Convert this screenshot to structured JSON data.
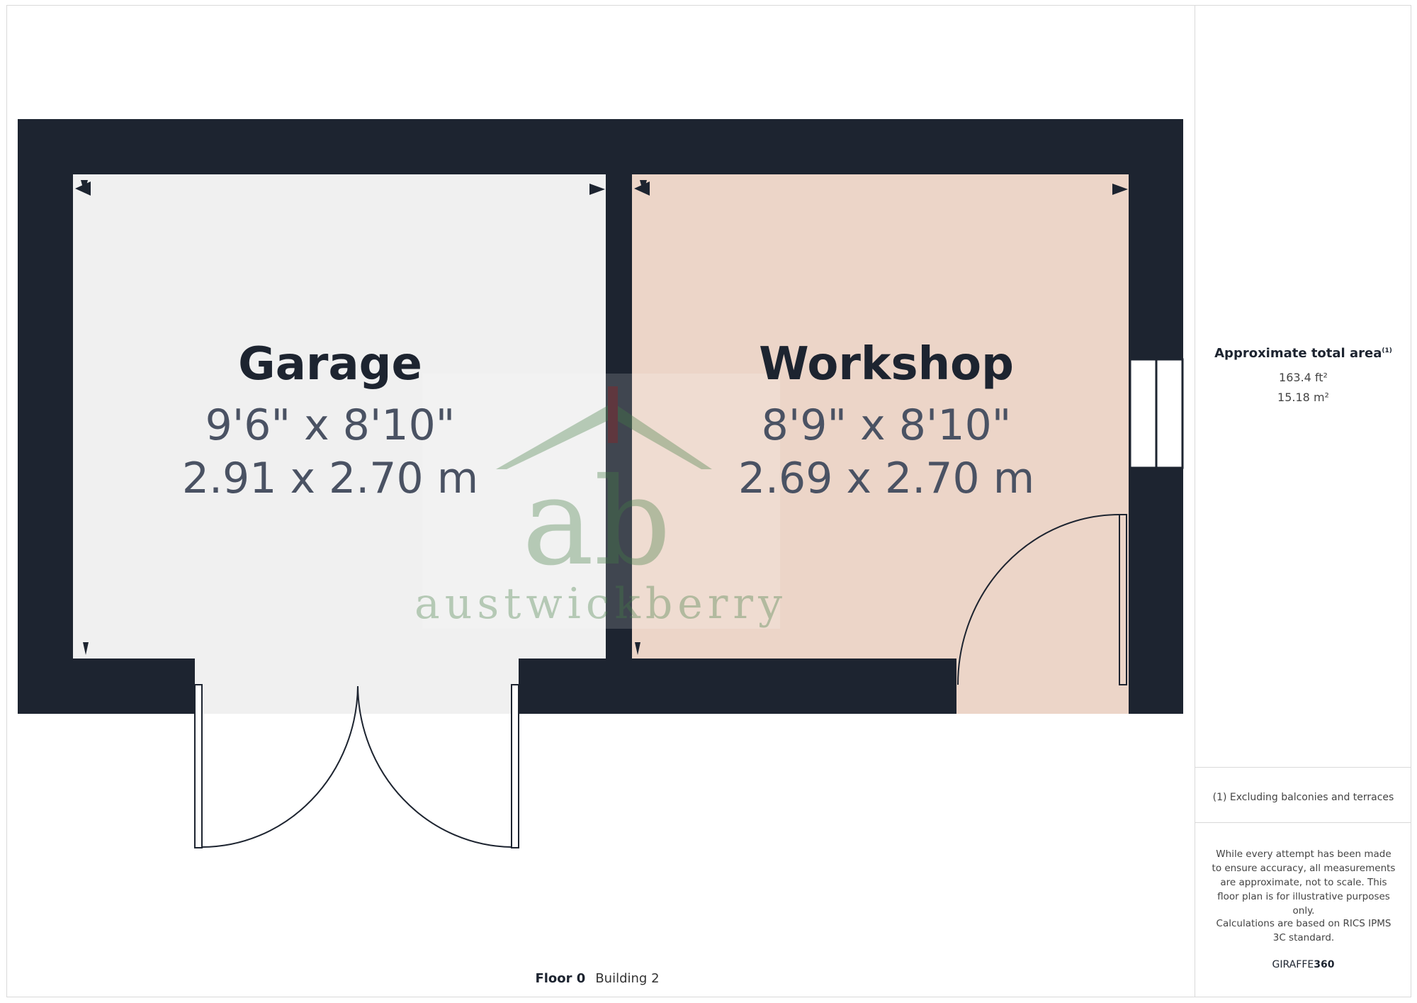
{
  "rooms": [
    {
      "name": "Garage",
      "dim_imperial": "9'6\" x 8'10\"",
      "dim_metric": "2.91 x 2.70 m",
      "fill": "#f0f0f0"
    },
    {
      "name": "Workshop",
      "dim_imperial": "8'9\" x 8'10\"",
      "dim_metric": "2.69 x 2.70 m",
      "fill": "#ecd5c8"
    }
  ],
  "watermark": {
    "letters": "ab",
    "text": "austwickberry"
  },
  "sidebar": {
    "area_title": "Approximate total area",
    "area_title_note": "(1)",
    "area_ft": "163.4 ft²",
    "area_m": "15.18 m²",
    "footnote": "(1) Excluding balconies and terraces",
    "disclaimer": "While every attempt has been made to ensure accuracy, all measurements are approximate, not to scale. This floor plan is for illustrative purposes only.",
    "calculation_note": "Calculations are based on RICS IPMS 3C standard.",
    "brand_prefix": "GIRAFFE",
    "brand_suffix": "360"
  },
  "floor": {
    "label": "Floor 0",
    "building": "Building 2"
  },
  "colors": {
    "wall": "#1d2430",
    "garage": "#f0f0f0",
    "workshop": "#ecd5c8"
  }
}
